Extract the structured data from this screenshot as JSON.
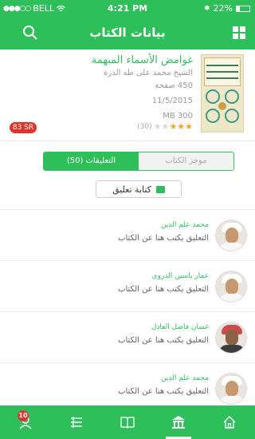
{
  "status_bar": {
    "carrier": "BELL",
    "time": "4:21 PM",
    "battery": "22%"
  },
  "header": {
    "title": "بيانات الكتاب"
  },
  "book": {
    "title": "غوامض الأسماء المبهمة",
    "author": "الشيخ محمد على طه الدرة",
    "pages": "450 صفحة",
    "date": "11/5/2015",
    "size": "300 MB",
    "rating": 3,
    "rating_max": 5,
    "rating_count": "(30)",
    "price": "83 SR"
  },
  "tabs": {
    "summary": "موجز الكتاب",
    "comments": "التعليقات (50)"
  },
  "write_comment_label": "كتابة تعليق",
  "comments": [
    {
      "name": "محمد علم الدين",
      "text": "التعليق يكتب هنا عن الكتاب"
    },
    {
      "name": "عمار ياسين الدروي",
      "text": "التعليق يكتب هنا عن الكتاب"
    },
    {
      "name": "غسان فاضل العادل",
      "text": "التعليق يكتب هنا عن الكتاب"
    },
    {
      "name": "محمد علم الدين",
      "text": "التعليق يكتب هنا عن الكتاب"
    }
  ],
  "tabbar": {
    "notification_count": "10"
  },
  "colors": {
    "accent": "#2fbf5a",
    "price_badge": "#e0342f",
    "star": "#f5a623"
  },
  "icons": [
    "search-icon",
    "grid-icon",
    "comment-icon",
    "profile-icon",
    "list-icon",
    "open-book-icon",
    "library-icon",
    "home-icon"
  ]
}
